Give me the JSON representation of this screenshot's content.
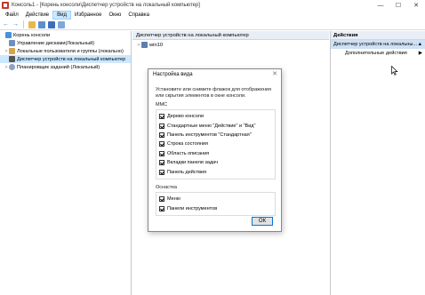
{
  "window": {
    "title": "Консоль1 - [Корень консоли\\Диспетчер устройств на локальный компьютер]",
    "minimize_glyph": "—",
    "maximize_glyph": "☐",
    "close_glyph": "✕"
  },
  "menu": [
    {
      "label": "Файл"
    },
    {
      "label": "Действие"
    },
    {
      "label": "Вид",
      "active": true
    },
    {
      "label": "Избранное"
    },
    {
      "label": "Окно"
    },
    {
      "label": "Справка"
    }
  ],
  "toolbar": {
    "back_glyph": "←",
    "forward_glyph": "→",
    "icons": [
      "back-icon",
      "forward-icon",
      "folder-icon",
      "console-tree-icon",
      "help-icon",
      "properties-icon"
    ]
  },
  "tree": {
    "root": "Корень консоли",
    "items": [
      {
        "label": "Управление дисками(Локальный)",
        "expander": ""
      },
      {
        "label": "Локальные пользователи и группы (локально)",
        "expander": ">"
      },
      {
        "label": "Диспетчер устройств на локальный компьютер",
        "expander": ""
      },
      {
        "label": "Планировщик заданий (Локальный)",
        "expander": ">"
      }
    ]
  },
  "center": {
    "header": "Диспетчер устройств на локальный компьютер",
    "computer": "win10",
    "expander": ">"
  },
  "actions": {
    "header": "Действия",
    "selected": "Диспетчер устройств на локальны...",
    "more": "Дополнительные действия",
    "arrow_up": "▲",
    "arrow_right": "▶"
  },
  "dialog": {
    "title": "Настройка вида",
    "close_glyph": "✕",
    "description": "Установите или снимите флажок для отображения или скрытия элементов в окне консоли.",
    "mmc_group": "MMC",
    "mmc_items": [
      {
        "label": "Дерево консоли",
        "checked": true
      },
      {
        "label": "Стандартные меню \"Действие\" и \"Вид\"",
        "checked": true
      },
      {
        "label": "Панель инструментов \"Стандартная\"",
        "checked": true
      },
      {
        "label": "Строка состояния",
        "checked": true
      },
      {
        "label": "Область описания",
        "checked": true
      },
      {
        "label": "Вкладки панели задач",
        "checked": true
      },
      {
        "label": "Панель действия",
        "checked": true
      }
    ],
    "snapin_group": "Оснастка",
    "snapin_items": [
      {
        "label": "Меню",
        "checked": true
      },
      {
        "label": "Панели инструментов",
        "checked": true
      }
    ],
    "ok": "ОК"
  },
  "colors": {
    "selection": "#cce8ff",
    "header_bg": "#e9eef6",
    "ok_border": "#0078d7"
  }
}
